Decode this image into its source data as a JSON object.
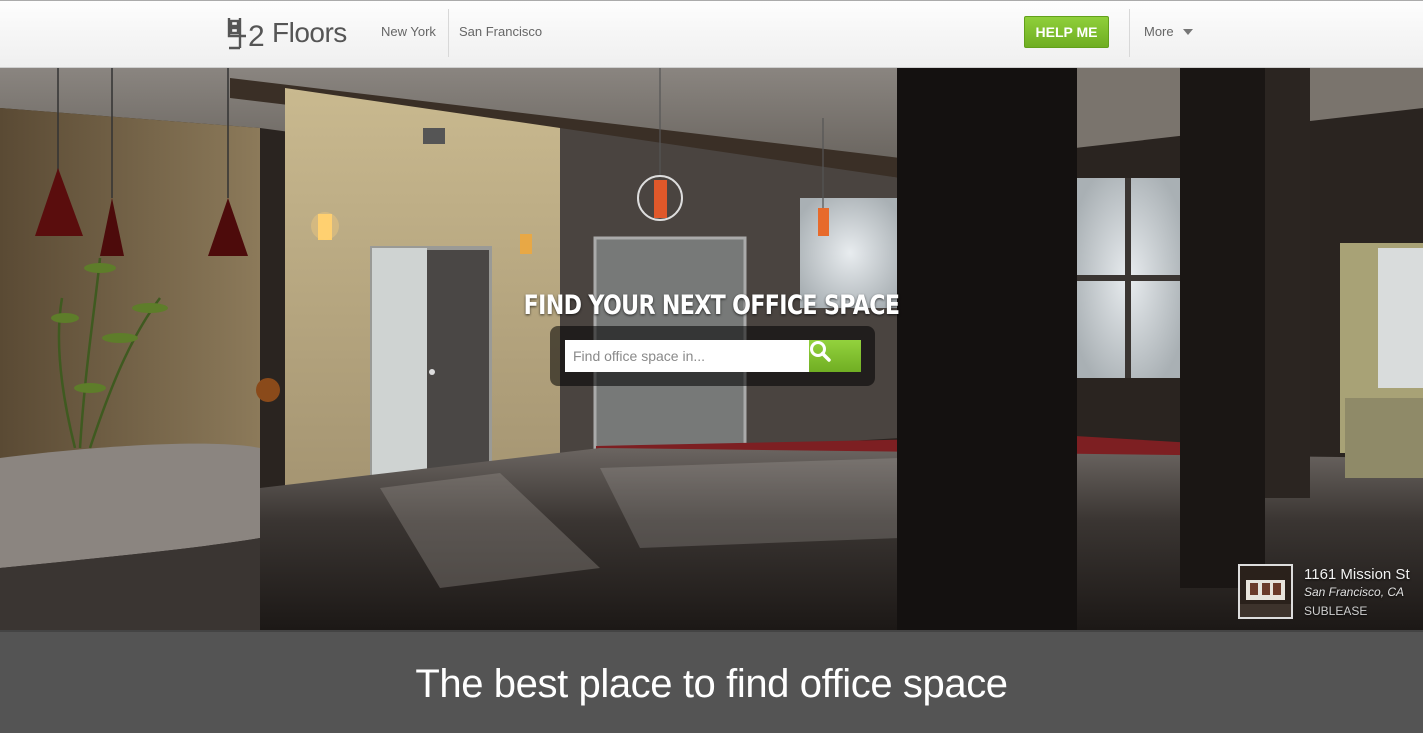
{
  "header": {
    "logo_text": "Floors",
    "logo_mark": "42",
    "nav": [
      {
        "label": "New York"
      },
      {
        "label": "San Francisco"
      }
    ],
    "help_label": "HELP ME",
    "more_label": "More"
  },
  "hero": {
    "title": "FIND YOUR NEXT OFFICE SPACE",
    "search_placeholder": "Find office space in...",
    "search_icon": "search-icon",
    "listing": {
      "address": "1161 Mission St",
      "city": "San Francisco, CA",
      "type": "SUBLEASE"
    }
  },
  "band": {
    "tagline": "The best place to find office space"
  },
  "colors": {
    "accent_green": "#7ab82b",
    "band_gray": "#545454"
  }
}
